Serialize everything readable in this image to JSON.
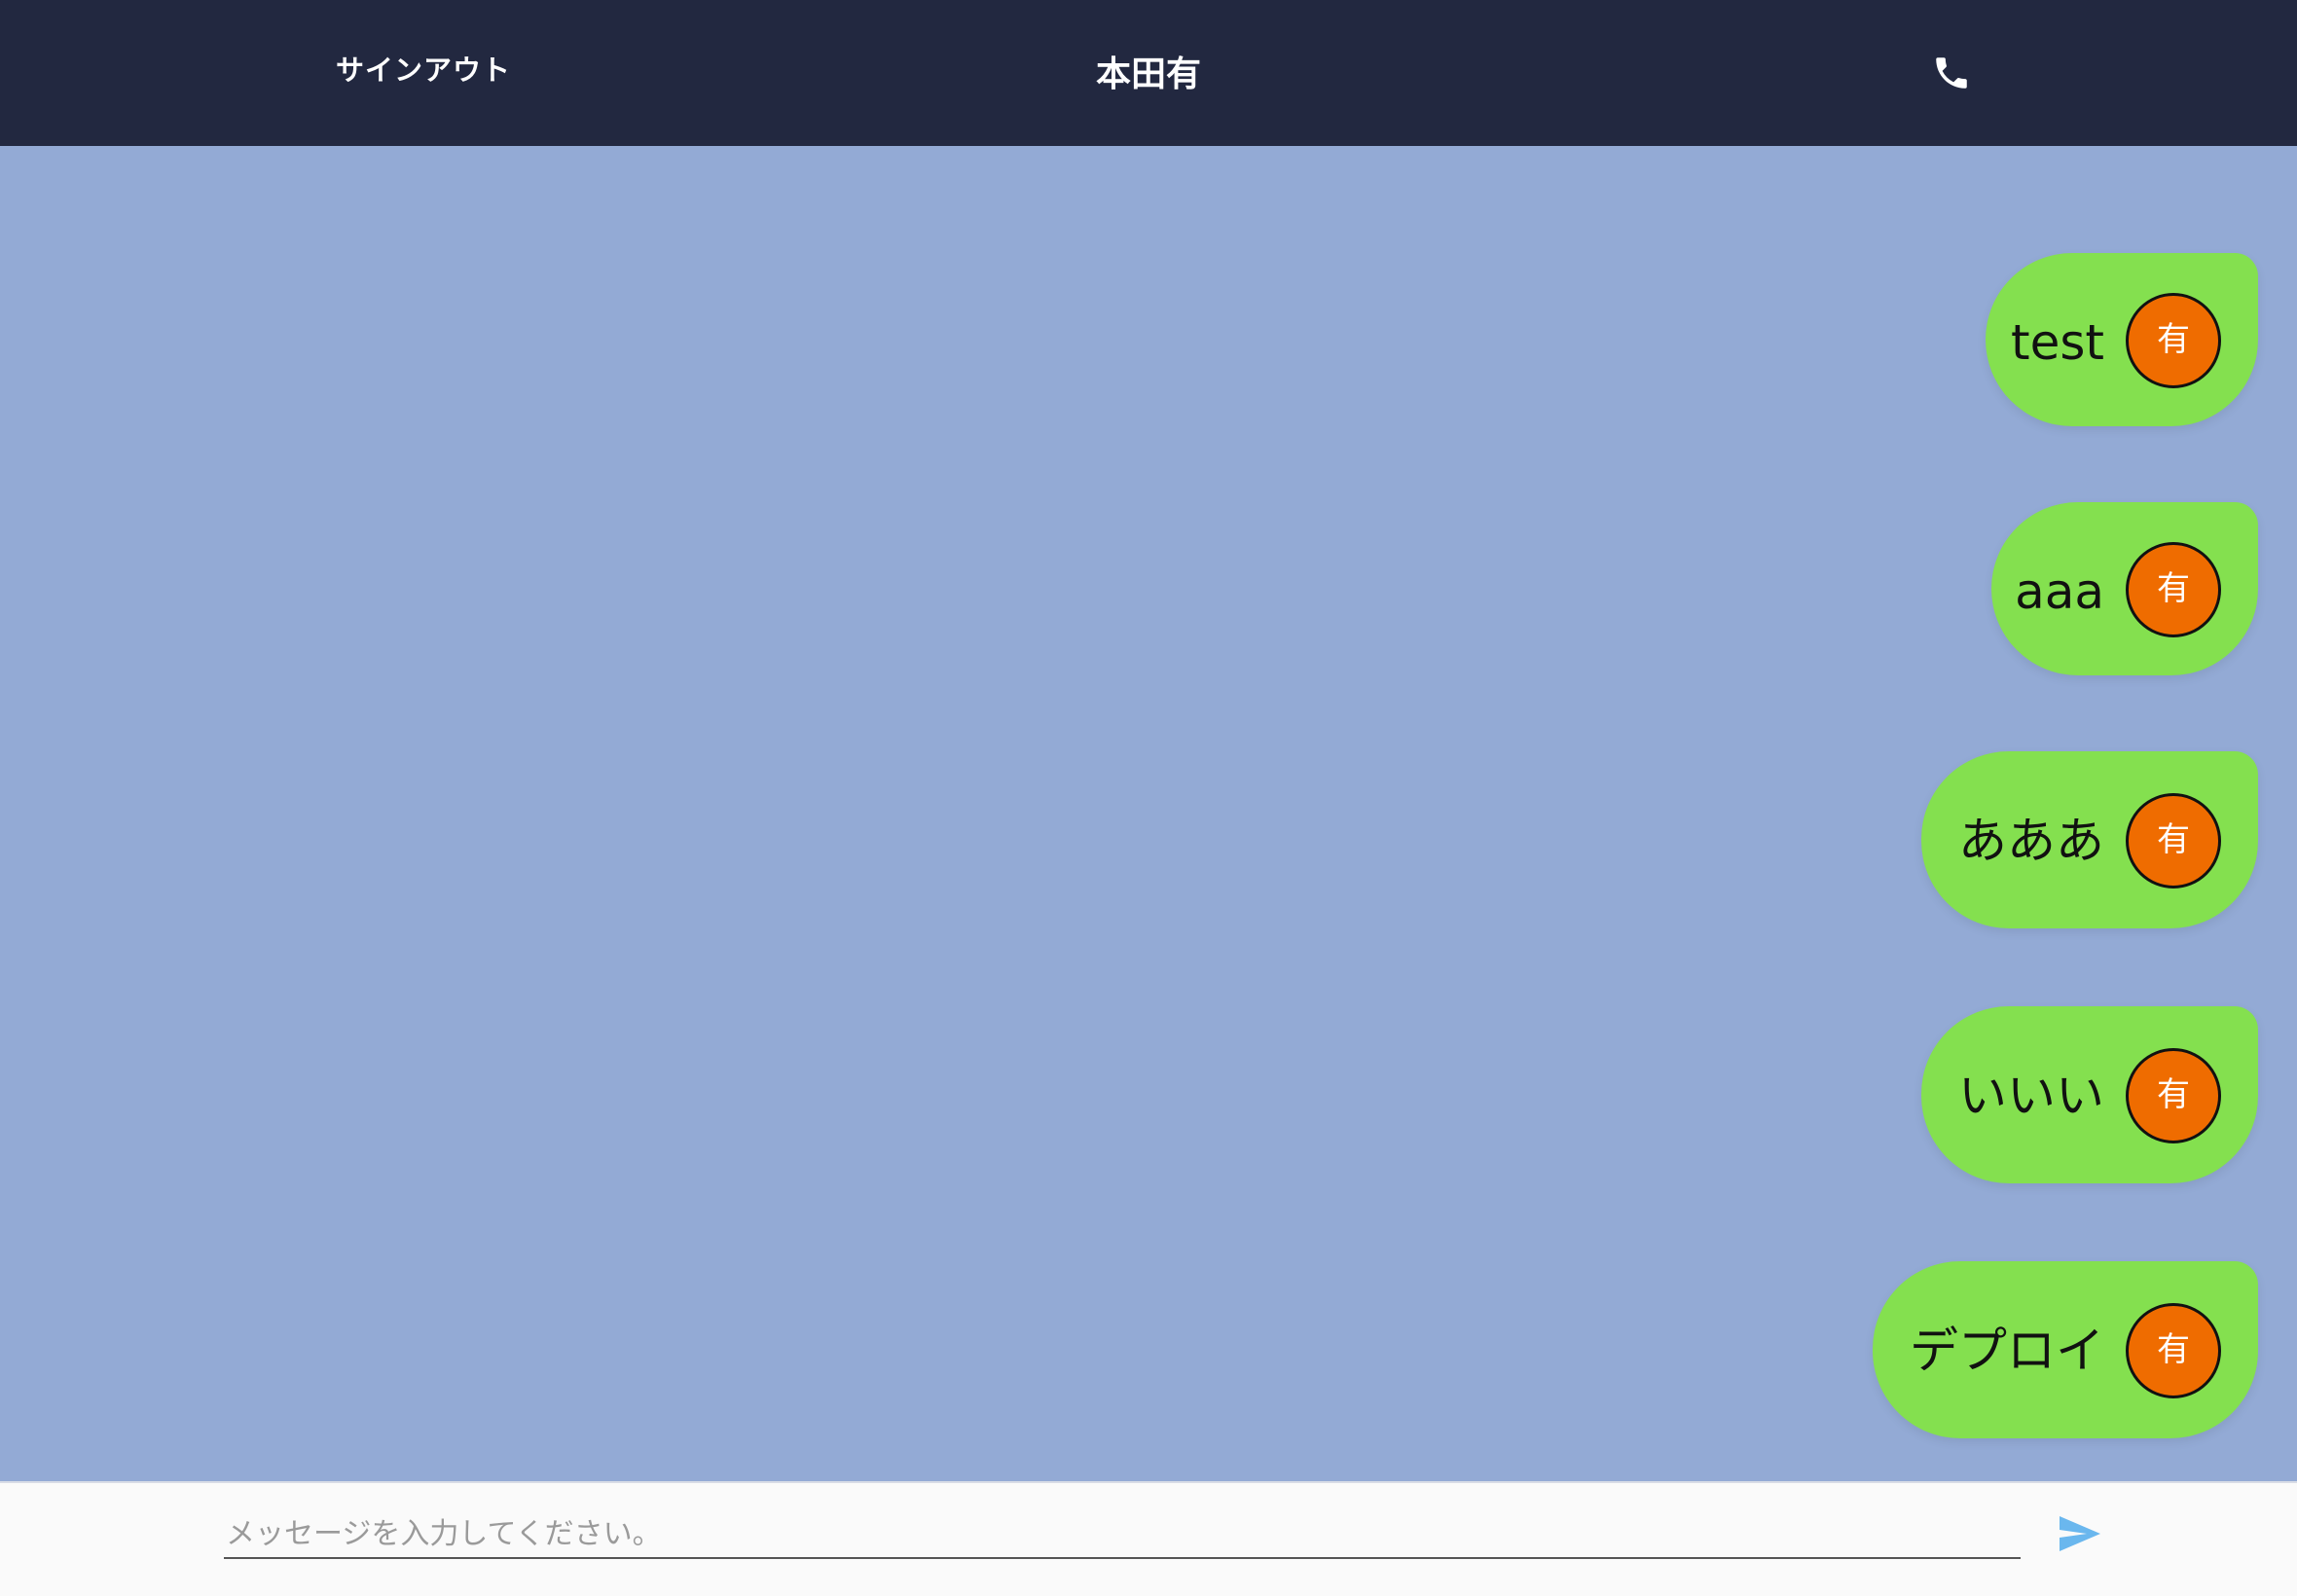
{
  "header": {
    "signout_label": "サインアウト",
    "title": "本田有",
    "phone_icon": "phone-icon"
  },
  "messages": [
    {
      "text": "test",
      "avatar": "有"
    },
    {
      "text": "aaa",
      "avatar": "有"
    },
    {
      "text": "あああ",
      "avatar": "有"
    },
    {
      "text": "いいい",
      "avatar": "有"
    },
    {
      "text": "デプロイ",
      "avatar": "有"
    }
  ],
  "composer": {
    "value": "",
    "placeholder": "メッセージを入力してください。",
    "send_icon": "send-icon"
  },
  "colors": {
    "header_bg": "#222840",
    "chat_bg": "#93aad5",
    "bubble": "#84e04f",
    "avatar": "#ef6c00",
    "send_icon": "#6ab7ee"
  }
}
